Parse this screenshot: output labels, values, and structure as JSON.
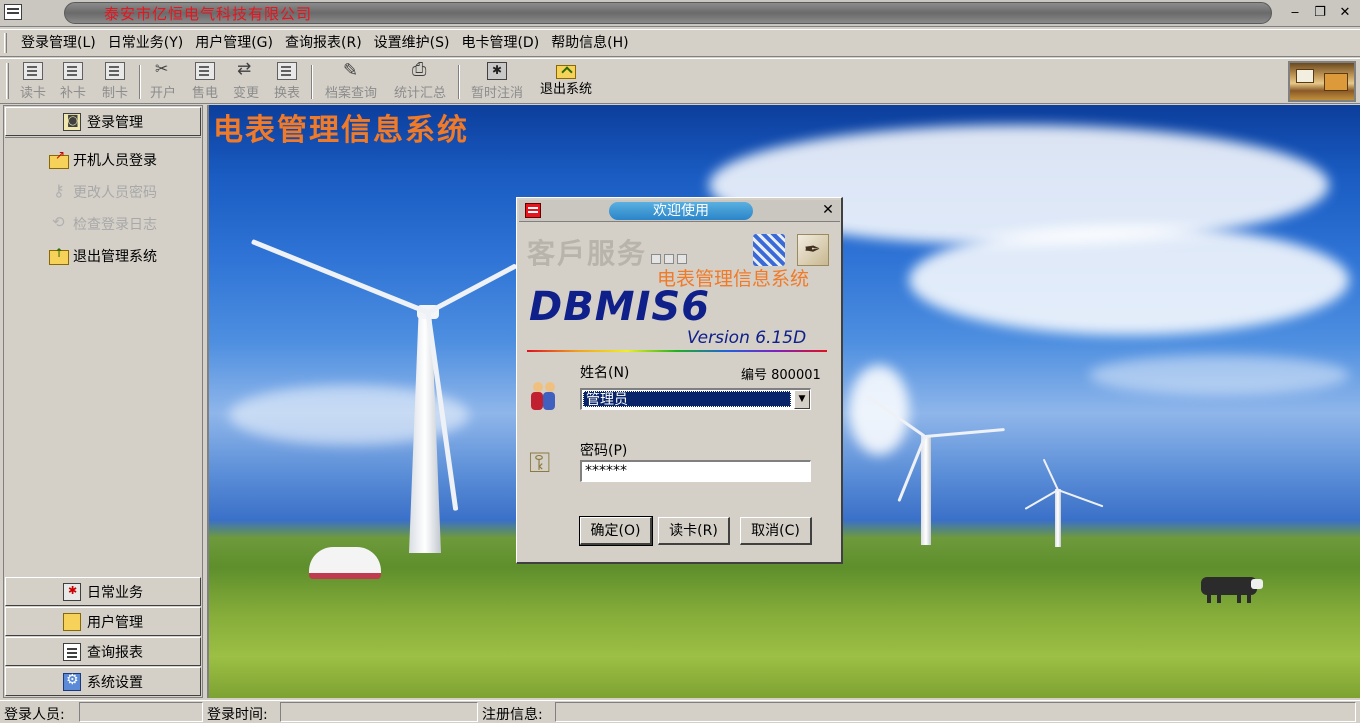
{
  "window": {
    "title": "泰安市亿恒电气科技有限公司",
    "controls": [
      "minimize",
      "restore",
      "close"
    ]
  },
  "menu": [
    {
      "label": "登录管理(L)"
    },
    {
      "label": "日常业务(Y)"
    },
    {
      "label": "用户管理(G)"
    },
    {
      "label": "查询报表(R)"
    },
    {
      "label": "设置维护(S)"
    },
    {
      "label": "电卡管理(D)"
    },
    {
      "label": "帮助信息(H)"
    }
  ],
  "toolbar": {
    "buttons": [
      {
        "label": "读卡",
        "icon": "read-card-icon",
        "enabled": false
      },
      {
        "label": "补卡",
        "icon": "reissue-card-icon",
        "enabled": false
      },
      {
        "label": "制卡",
        "icon": "make-card-icon",
        "enabled": false
      },
      {
        "label": "开户",
        "icon": "open-account-icon",
        "enabled": false
      },
      {
        "label": "售电",
        "icon": "sell-power-icon",
        "enabled": false
      },
      {
        "label": "变更",
        "icon": "change-icon",
        "enabled": false
      },
      {
        "label": "换表",
        "icon": "replace-meter-icon",
        "enabled": false
      },
      {
        "label": "档案查询",
        "icon": "archive-query-icon",
        "enabled": false
      },
      {
        "label": "统计汇总",
        "icon": "statistics-icon",
        "enabled": false
      },
      {
        "label": "暂时注消",
        "icon": "logout-temp-icon",
        "enabled": false
      },
      {
        "label": "退出系统",
        "icon": "exit-system-icon",
        "enabled": true
      }
    ]
  },
  "sidebar": {
    "active_section": {
      "label": "登录管理",
      "icon": "login-icon"
    },
    "items": [
      {
        "label": "开机人员登录",
        "enabled": true,
        "icon": "login-open-icon"
      },
      {
        "label": "更改人员密码",
        "enabled": false,
        "icon": "key-icon"
      },
      {
        "label": "检查登录日志",
        "enabled": false,
        "icon": "log-icon"
      },
      {
        "label": "退出管理系统",
        "enabled": true,
        "icon": "exit-icon"
      }
    ],
    "sections": [
      {
        "label": "日常业务",
        "icon": "daily-icon"
      },
      {
        "label": "用户管理",
        "icon": "users-icon"
      },
      {
        "label": "查询报表",
        "icon": "report-icon"
      },
      {
        "label": "系统设置",
        "icon": "settings-icon"
      }
    ]
  },
  "main": {
    "title": "电表管理信息系统"
  },
  "dialog": {
    "title": "欢迎使用",
    "brand": "客戶服务",
    "subtitle": "电表管理信息系统",
    "product": "DBMIS6",
    "version": "Version  6.15D",
    "name_label": "姓名(N)",
    "emp_no": "编号  800001",
    "name_value": "管理员",
    "password_label": "密码(P)",
    "password_value": "******",
    "buttons": {
      "ok": "确定(O)",
      "read_card": "读卡(R)",
      "cancel": "取消(C)"
    }
  },
  "status": {
    "user_label": "登录人员:",
    "time_label": "登录时间:",
    "reg_label": "注册信息:"
  }
}
